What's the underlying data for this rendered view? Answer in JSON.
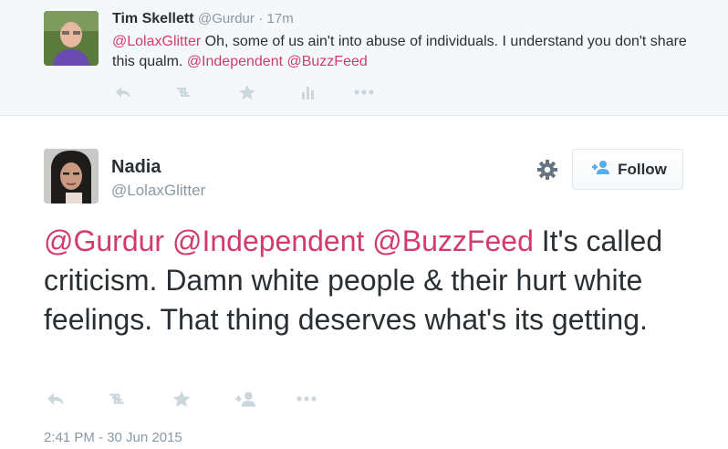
{
  "reply": {
    "name": "Tim Skellett",
    "handle": "@Gurdur",
    "time": "· 17m",
    "text_mention": "@LolaxGlitter",
    "text_body": " Oh, some of us ain't into abuse of individuals. I understand you don't share this qualm. ",
    "mention2": "@Independent",
    "mention3": "@BuzzFeed"
  },
  "tweet": {
    "name": "Nadia",
    "handle": "@LolaxGlitter",
    "follow_label": "Follow",
    "mention1": "@Gurdur",
    "mention2": "@Independent",
    "mention3": "@BuzzFeed",
    "body": " It's called criticism. Damn white people & their hurt white feelings. That thing deserves what's its getting.",
    "timestamp": "2:41 PM - 30 Jun 2015"
  },
  "colors": {
    "mention": "#d23c6a",
    "muted": "#8899a6",
    "icon": "#ccd6dd",
    "follow_accent": "#55acee"
  }
}
